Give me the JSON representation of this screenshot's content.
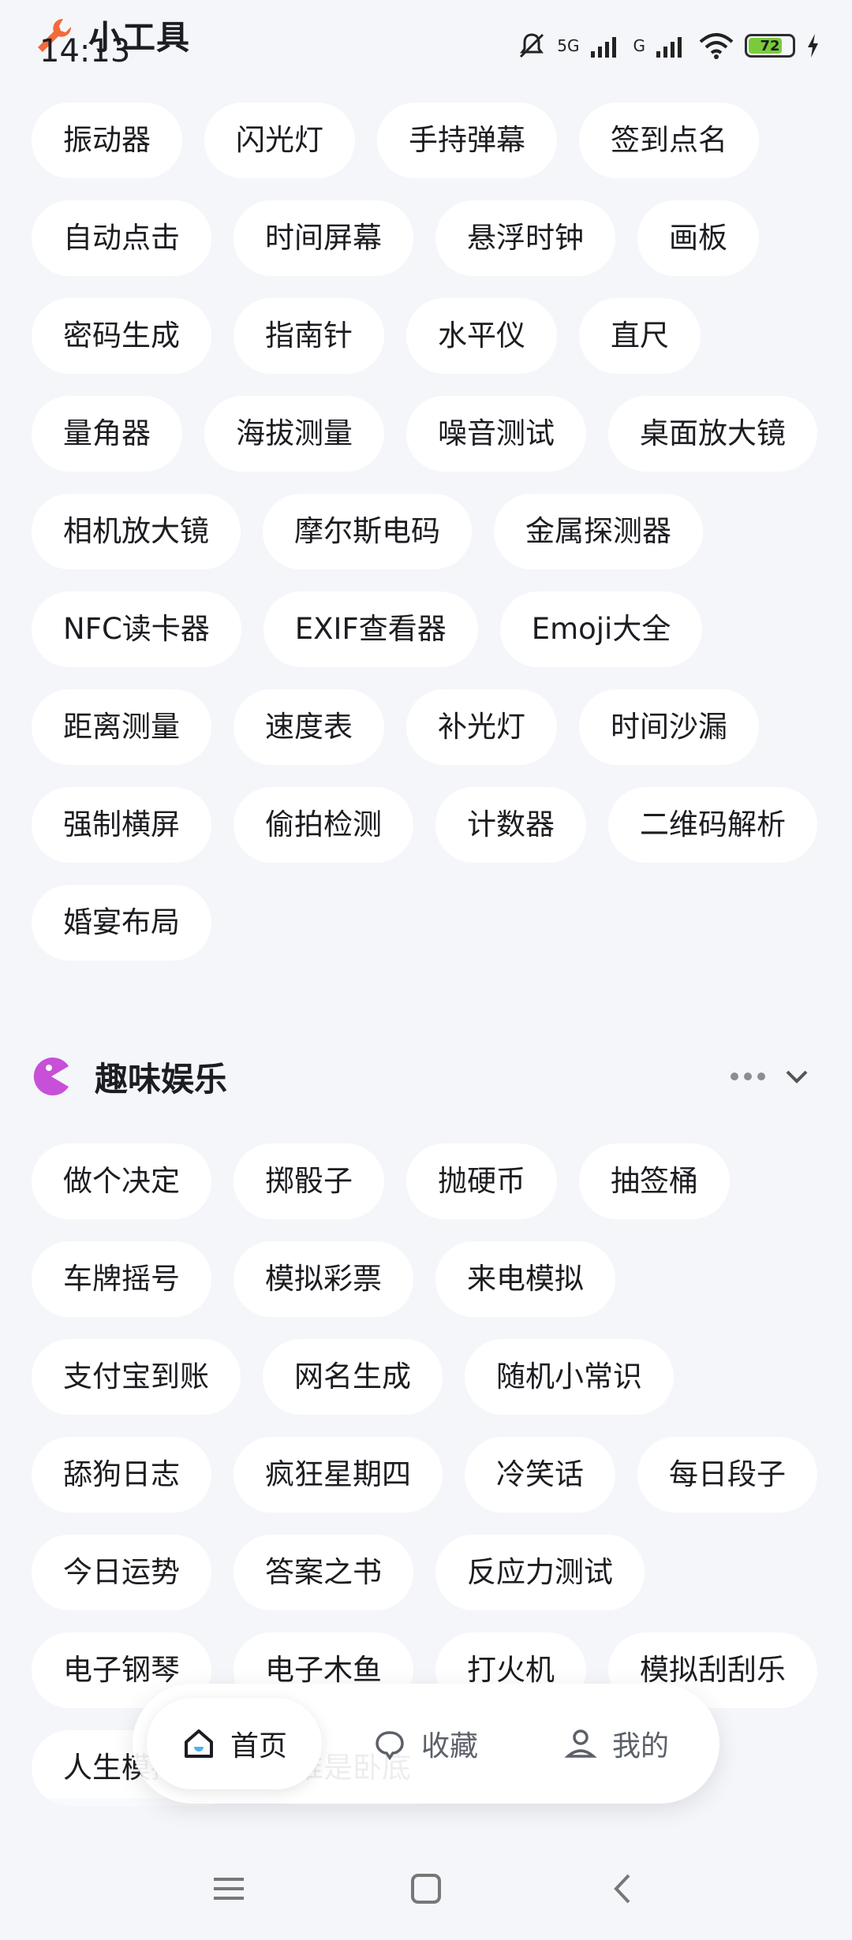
{
  "status_bar": {
    "time": "14:13",
    "signal1": "5G",
    "signal2": "G",
    "battery": "72"
  },
  "section1": {
    "title": "小工具",
    "items": [
      "振动器",
      "闪光灯",
      "手持弹幕",
      "签到点名",
      "自动点击",
      "时间屏幕",
      "悬浮时钟",
      "画板",
      "密码生成",
      "指南针",
      "水平仪",
      "直尺",
      "量角器",
      "海拔测量",
      "噪音测试",
      "桌面放大镜",
      "相机放大镜",
      "摩尔斯电码",
      "金属探测器",
      "NFC读卡器",
      "EXIF查看器",
      "Emoji大全",
      "距离测量",
      "速度表",
      "补光灯",
      "时间沙漏",
      "强制横屏",
      "偷拍检测",
      "计数器",
      "二维码解析",
      "婚宴布局"
    ]
  },
  "section2": {
    "title": "趣味娱乐",
    "items": [
      "做个决定",
      "掷骰子",
      "抛硬币",
      "抽签桶",
      "车牌摇号",
      "模拟彩票",
      "来电模拟",
      "支付宝到账",
      "网名生成",
      "随机小常识",
      "舔狗日志",
      "疯狂星期四",
      "冷笑话",
      "每日段子",
      "今日运势",
      "答案之书",
      "反应力测试",
      "电子钢琴",
      "电子木鱼",
      "打火机",
      "模拟刮刮乐",
      "人生模拟器",
      "谁是卧底"
    ]
  },
  "nav": {
    "home": "首页",
    "favorites": "收藏",
    "mine": "我的"
  },
  "colors": {
    "page_bg": "#f4f6fa",
    "chip_bg": "#ffffff",
    "accent_orange": "#f26b3a",
    "accent_purple": "#c84fd8"
  }
}
